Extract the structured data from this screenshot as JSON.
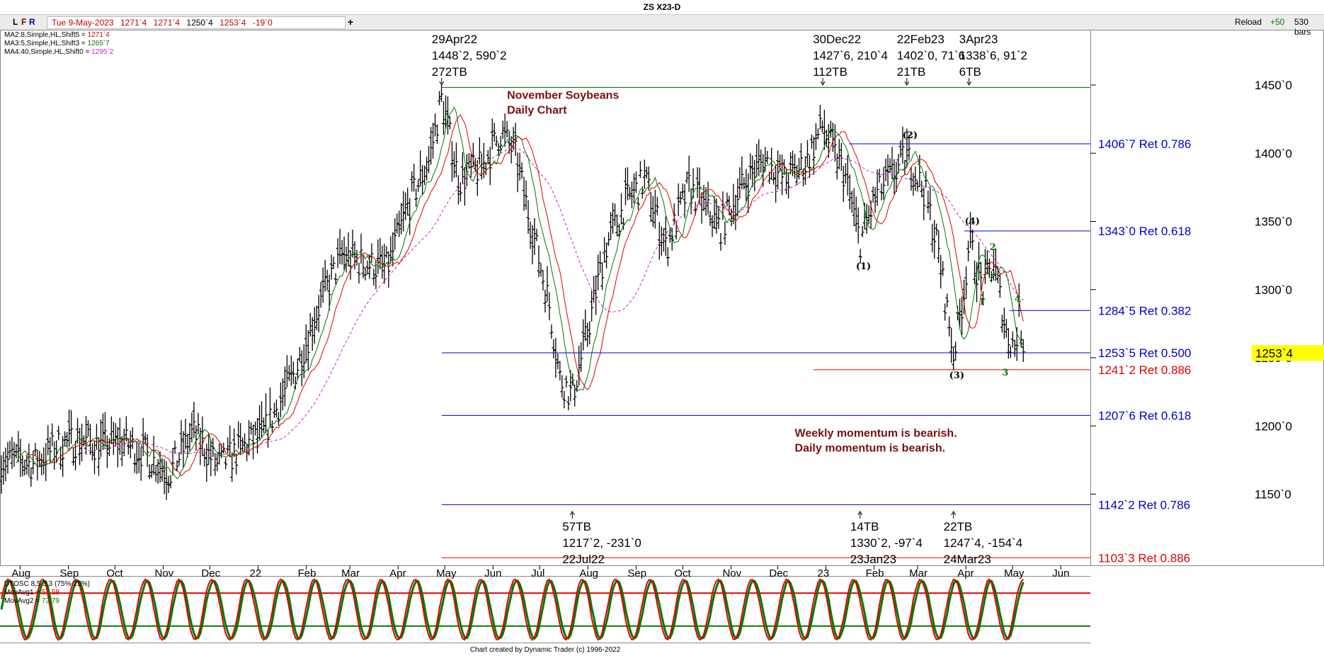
{
  "header": {
    "title": "ZS X23-D"
  },
  "toolbar": {
    "buttons": [
      {
        "label": "L",
        "color": "#000000"
      },
      {
        "label": "F",
        "color": "#8b0000"
      },
      {
        "label": "R",
        "color": "#0000aa"
      }
    ],
    "quote": {
      "date": "Tue 9-May-2023",
      "open": "1271`4",
      "high": "1271`4",
      "low": "1250`4",
      "close": "1253`4",
      "change": "-19`0"
    },
    "plus_label": "+",
    "reload_label": "Reload",
    "reload_step": "+50",
    "bars_label": "530 bars"
  },
  "legend": {
    "ma2": {
      "label": "MA2:8,Simple,HL,Shift5 = ",
      "value": "1271`4",
      "color": "#e00000"
    },
    "ma3": {
      "label": "MA3:5,Simple,HL,Shift3 = ",
      "value": "1265`7",
      "color": "#007a00"
    },
    "ma4": {
      "label": "MA4:40,Simple,HL,Shift0 = ",
      "value": "1295`2",
      "color": "#d020d0"
    }
  },
  "oscillator": {
    "name": "DTOSC 8,5,3,3 (75%-25%)",
    "ma1_label": "MovAvg1 = ",
    "ma1_value": "51.58",
    "ma2_label": "MovAvg2 = ",
    "ma2_value": "73.79",
    "upper": 75,
    "lower": 25
  },
  "footer": {
    "credit": "Chart created by Dynamic Trader  (c) 1996-2022"
  },
  "chart_data": {
    "type": "ohlc_bar",
    "title": "ZS X23-D",
    "y_axis": {
      "min": 1090,
      "max": 1490,
      "ticks": [
        1150,
        1200,
        1250,
        1300,
        1350,
        1400,
        1450
      ],
      "tick_labels": [
        "1150`0",
        "1200`0",
        "1250`0",
        "1300`0",
        "1350`0",
        "1400`0",
        "1450`0"
      ]
    },
    "x_axis": {
      "labels": [
        {
          "text": "Aug",
          "date": "2021-08-01"
        },
        {
          "text": "Sep",
          "date": "2021-09-01"
        },
        {
          "text": "Oct",
          "date": "2021-10-01"
        },
        {
          "text": "Nov",
          "date": "2021-11-01"
        },
        {
          "text": "Dec",
          "date": "2021-12-01"
        },
        {
          "text": "22",
          "date": "2022-01-01"
        },
        {
          "text": "Feb",
          "date": "2022-02-01"
        },
        {
          "text": "Mar",
          "date": "2022-03-01"
        },
        {
          "text": "Apr",
          "date": "2022-04-01"
        },
        {
          "text": "May",
          "date": "2022-05-01"
        },
        {
          "text": "Jun",
          "date": "2022-06-01"
        },
        {
          "text": "Jul",
          "date": "2022-07-01"
        },
        {
          "text": "Aug",
          "date": "2022-08-01"
        },
        {
          "text": "Sep",
          "date": "2022-09-01"
        },
        {
          "text": "Oct",
          "date": "2022-10-01"
        },
        {
          "text": "Nov",
          "date": "2022-11-01"
        },
        {
          "text": "Dec",
          "date": "2022-12-01"
        },
        {
          "text": "23",
          "date": "2023-01-01"
        },
        {
          "text": "Feb",
          "date": "2023-02-01"
        },
        {
          "text": "Mar",
          "date": "2023-03-01"
        },
        {
          "text": "Apr",
          "date": "2023-04-01"
        },
        {
          "text": "May",
          "date": "2023-05-01"
        },
        {
          "text": "Jun",
          "date": "2023-06-01"
        }
      ]
    },
    "price_anchors": [
      [
        "2021-07-20",
        1175
      ],
      [
        "2021-08-10",
        1172
      ],
      [
        "2021-08-25",
        1185
      ],
      [
        "2021-09-08",
        1190
      ],
      [
        "2021-09-22",
        1185
      ],
      [
        "2021-10-05",
        1188
      ],
      [
        "2021-10-20",
        1180
      ],
      [
        "2021-11-05",
        1165
      ],
      [
        "2021-11-20",
        1195
      ],
      [
        "2021-12-06",
        1170
      ],
      [
        "2021-12-20",
        1182
      ],
      [
        "2022-01-05",
        1195
      ],
      [
        "2022-01-25",
        1240
      ],
      [
        "2022-02-10",
        1290
      ],
      [
        "2022-02-24",
        1325
      ],
      [
        "2022-03-08",
        1320
      ],
      [
        "2022-03-25",
        1315
      ],
      [
        "2022-04-07",
        1360
      ],
      [
        "2022-04-21",
        1395
      ],
      [
        "2022-04-29",
        1440
      ],
      [
        "2022-05-10",
        1380
      ],
      [
        "2022-05-25",
        1390
      ],
      [
        "2022-06-06",
        1415
      ],
      [
        "2022-06-15",
        1400
      ],
      [
        "2022-06-25",
        1350
      ],
      [
        "2022-07-07",
        1290
      ],
      [
        "2022-07-14",
        1235
      ],
      [
        "2022-07-22",
        1222
      ],
      [
        "2022-08-01",
        1270
      ],
      [
        "2022-08-12",
        1330
      ],
      [
        "2022-08-26",
        1365
      ],
      [
        "2022-09-07",
        1380
      ],
      [
        "2022-09-20",
        1330
      ],
      [
        "2022-10-05",
        1375
      ],
      [
        "2022-10-25",
        1345
      ],
      [
        "2022-11-08",
        1375
      ],
      [
        "2022-11-22",
        1395
      ],
      [
        "2022-12-06",
        1380
      ],
      [
        "2022-12-19",
        1392
      ],
      [
        "2022-12-30",
        1420
      ],
      [
        "2023-01-06",
        1400
      ],
      [
        "2023-01-13",
        1385
      ],
      [
        "2023-01-23",
        1335
      ],
      [
        "2023-02-03",
        1370
      ],
      [
        "2023-02-14",
        1385
      ],
      [
        "2023-02-22",
        1398
      ],
      [
        "2023-03-06",
        1370
      ],
      [
        "2023-03-14",
        1330
      ],
      [
        "2023-03-24",
        1252
      ],
      [
        "2023-03-31",
        1300
      ],
      [
        "2023-04-03",
        1335
      ],
      [
        "2023-04-12",
        1300
      ],
      [
        "2023-04-19",
        1320
      ],
      [
        "2023-04-27",
        1268
      ],
      [
        "2023-05-03",
        1257
      ],
      [
        "2023-05-05",
        1282
      ],
      [
        "2023-05-09",
        1253.5
      ]
    ],
    "horizontal_lines": [
      {
        "price": 1448.25,
        "from": "2022-04-29",
        "to": "2023-06-20",
        "color": "#006400"
      },
      {
        "price": 1406.875,
        "from": "2023-01-16",
        "to": "2023-06-20",
        "color": "#0000cc",
        "label": "1406`7 Ret 0.786"
      },
      {
        "price": 1343.0,
        "from": "2023-03-31",
        "to": "2023-06-20",
        "color": "#0000cc",
        "label": "1343`0 Ret 0.618"
      },
      {
        "price": 1284.625,
        "from": "2023-04-29",
        "to": "2023-06-20",
        "color": "#0000cc",
        "label": "1284`5 Ret 0.382"
      },
      {
        "price": 1253.625,
        "from": "2022-04-29",
        "to": "2023-06-20",
        "color": "#0000cc",
        "label": "1253`5 Ret 0.500"
      },
      {
        "price": 1241.25,
        "from": "2022-12-24",
        "to": "2023-06-20",
        "color": "#e00000",
        "label": "1241`2 Ret 0.886"
      },
      {
        "price": 1207.75,
        "from": "2022-04-29",
        "to": "2023-06-20",
        "color": "#0000cc",
        "label": "1207`6 Ret 0.618"
      },
      {
        "price": 1142.25,
        "from": "2022-04-29",
        "to": "2023-06-20",
        "color": "#0000cc",
        "label": "1142`2 Ret 0.786"
      },
      {
        "price": 1103.375,
        "from": "2022-04-29",
        "to": "2023-06-20",
        "color": "#e00000",
        "label": "1103`3 Ret 0.886"
      }
    ],
    "pivot_annotations": [
      {
        "date": "2022-04-29",
        "price": 1448.25,
        "pos": "top",
        "lines": [
          "29Apr22",
          "1448`2, 590`2",
          "272TB"
        ]
      },
      {
        "date": "2022-12-30",
        "price": 1427.75,
        "pos": "top",
        "lines": [
          "30Dec22",
          "1427`6, 210`4",
          "112TB"
        ]
      },
      {
        "date": "2023-02-22",
        "price": 1402.0,
        "pos": "top",
        "lines": [
          "22Feb23",
          "1402`0, 71`6",
          "21TB"
        ]
      },
      {
        "date": "2023-04-03",
        "price": 1338.75,
        "pos": "top",
        "lines": [
          "3Apr23",
          "1338`6, 91`2",
          "6TB"
        ]
      },
      {
        "date": "2022-07-22",
        "price": 1217.25,
        "pos": "bottom",
        "lines": [
          "57TB",
          "1217`2, -231`0",
          "22Jul22"
        ]
      },
      {
        "date": "2023-01-23",
        "price": 1330.25,
        "pos": "bottom",
        "lines": [
          "14TB",
          "1330`2, -97`4",
          "23Jan23"
        ]
      },
      {
        "date": "2023-03-24",
        "price": 1247.5,
        "pos": "bottom",
        "lines": [
          "22TB",
          "1247`4, -154`4",
          "24Mar23"
        ]
      }
    ],
    "wave_labels": [
      {
        "text": "(1)",
        "date": "2023-01-23",
        "price": 1315,
        "color": "#000000"
      },
      {
        "text": "(2)",
        "date": "2023-02-22",
        "price": 1411,
        "color": "#000000"
      },
      {
        "text": "(3)",
        "date": "2023-03-24",
        "price": 1235,
        "color": "#000000"
      },
      {
        "text": "(4)",
        "date": "2023-04-03",
        "price": 1348,
        "color": "#000000"
      },
      {
        "text": "1",
        "date": "2023-04-12",
        "price": 1289,
        "color": "#007a00"
      },
      {
        "text": "2",
        "date": "2023-04-19",
        "price": 1329,
        "color": "#007a00"
      },
      {
        "text": "3",
        "date": "2023-04-27",
        "price": 1237,
        "color": "#007a00"
      },
      {
        "text": "4",
        "date": "2023-05-05",
        "price": 1291,
        "color": "#007a00"
      }
    ],
    "text_annotations": [
      {
        "lines": [
          "November Soybeans",
          "Daily Chart"
        ],
        "date": "2022-06-10",
        "price": 1440,
        "color": "#7a1010"
      },
      {
        "lines": [
          "Weekly momentum is bearish.",
          "Daily momentum is bearish."
        ],
        "date": "2022-12-12",
        "price": 1192,
        "color": "#7a1010"
      }
    ],
    "last_price": {
      "label": "1253`4",
      "value": 1253.5,
      "color": "#ffff00"
    }
  }
}
